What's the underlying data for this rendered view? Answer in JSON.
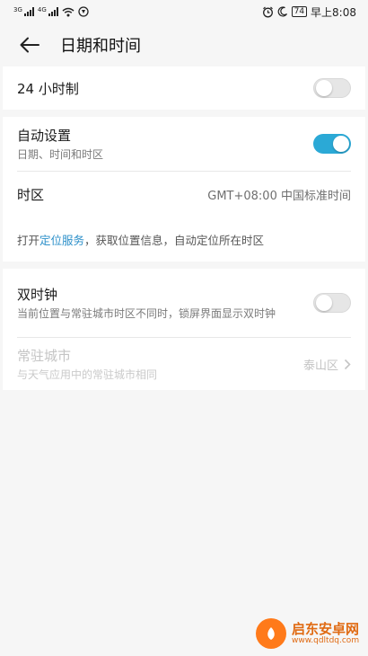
{
  "status_bar": {
    "signal1_tag": "3G",
    "signal2_tag": "4G",
    "battery": "74",
    "time": "早上8:08"
  },
  "header": {
    "back_icon": "arrow-left-icon",
    "title": "日期和时间"
  },
  "hour24": {
    "label": "24 小时制",
    "enabled": false
  },
  "auto_setting": {
    "label": "自动设置",
    "subtitle": "日期、时间和时区",
    "enabled": true
  },
  "timezone": {
    "label": "时区",
    "value": "GMT+08:00 中国标准时间"
  },
  "location_hint": {
    "prefix": "打开",
    "link": "定位服务",
    "suffix": "，获取位置信息，自动定位所在时区"
  },
  "dual_clock": {
    "label": "双时钟",
    "subtitle": "当前位置与常驻城市时区不同时，锁屏界面显示双时钟",
    "enabled": false
  },
  "home_city": {
    "label": "常驻城市",
    "subtitle": "与天气应用中的常驻城市相同",
    "value": "泰山区"
  },
  "watermark": {
    "main": "启东安卓网",
    "sub": "www.qdltdq.com"
  },
  "colors": {
    "accent": "#2ba9d6",
    "link": "#2b8fc9"
  }
}
